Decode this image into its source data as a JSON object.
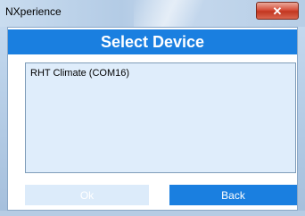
{
  "window": {
    "title": "NXperience",
    "close_glyph": "✕"
  },
  "dialog": {
    "header": "Select Device",
    "devices": [
      "RHT Climate (COM16)"
    ],
    "ok_label": "Ok",
    "back_label": "Back"
  },
  "colors": {
    "accent": "#1a7fe0",
    "list_background": "#dfedfb",
    "disabled_button": "#dcebfa"
  },
  "icons": {
    "close": "close-icon"
  }
}
